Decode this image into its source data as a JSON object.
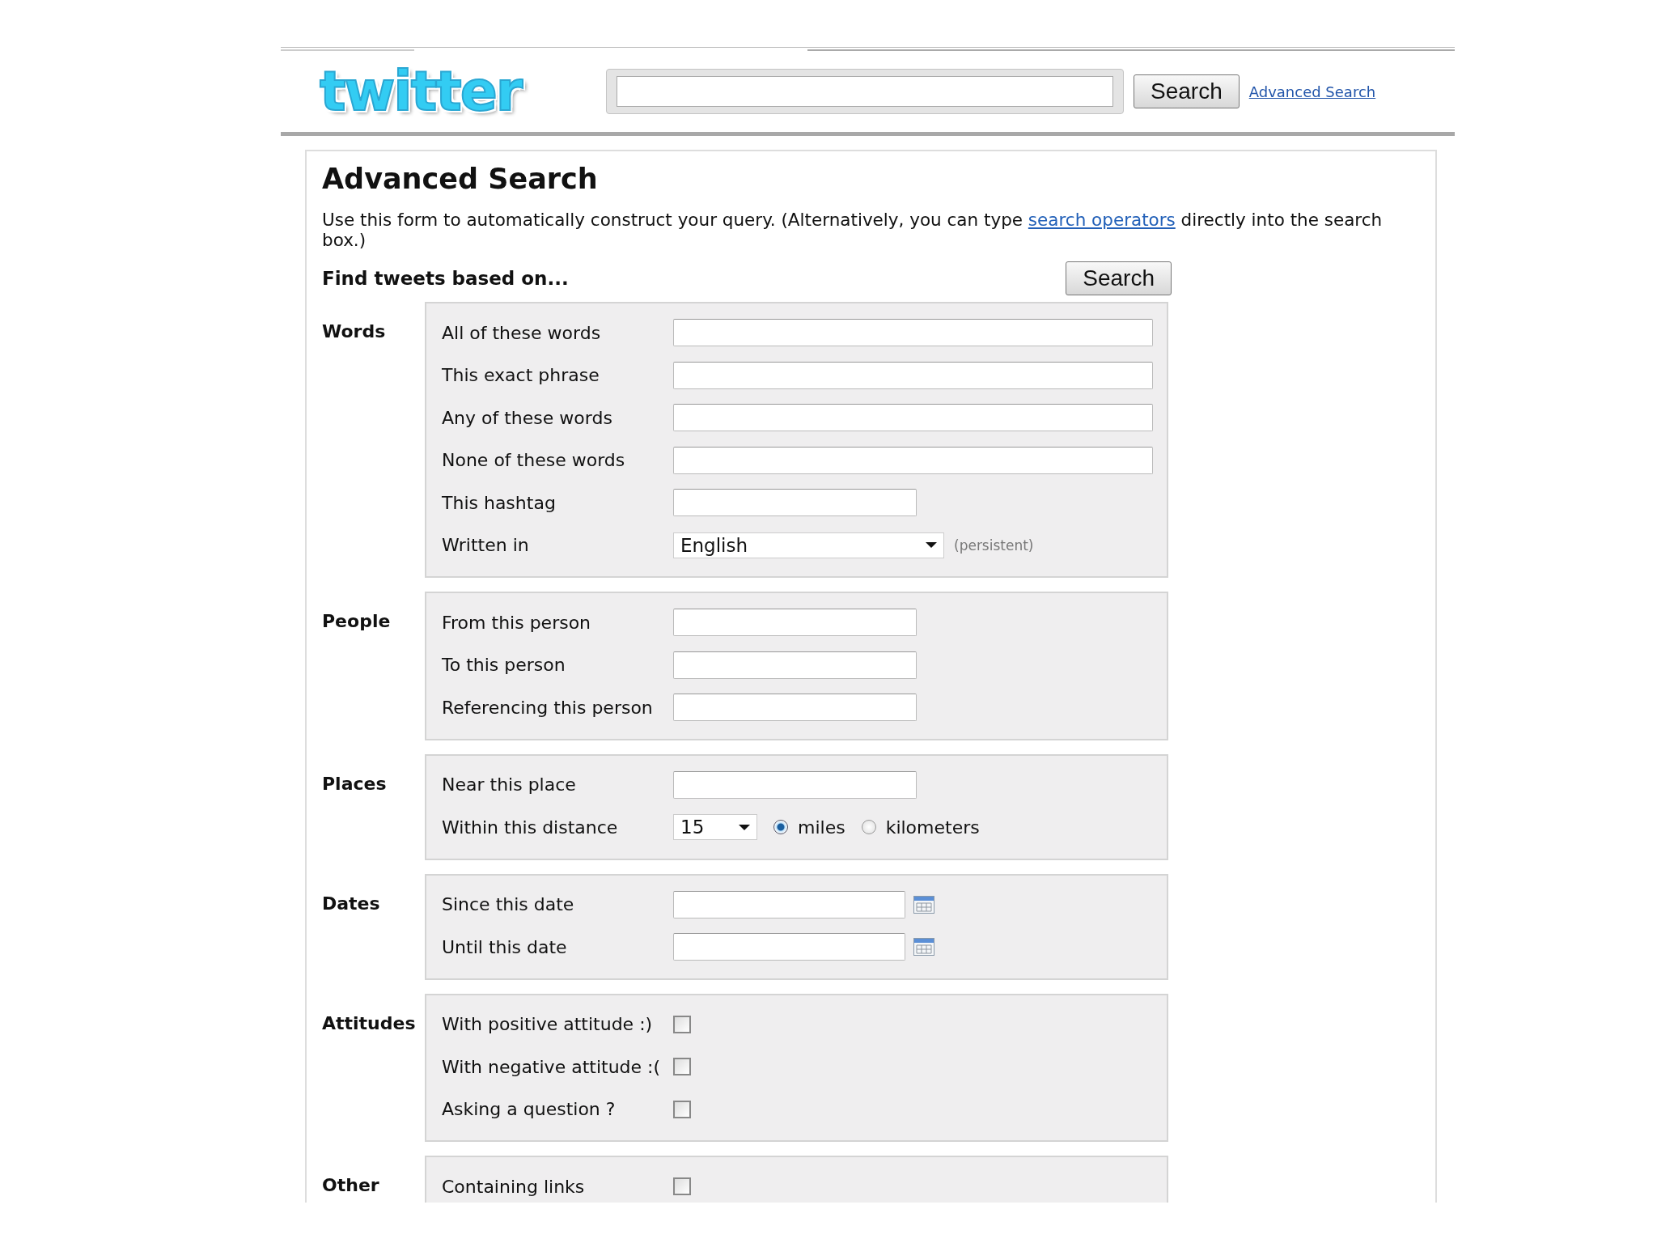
{
  "header": {
    "logo": "twitter",
    "search_button": "Search",
    "advanced_link": "Advanced Search"
  },
  "title": "Advanced Search",
  "intro": {
    "before": "Use this form to automatically construct your query. (Alternatively, you can type ",
    "link": "search operators",
    "after": " directly into the search box.)"
  },
  "find_label": "Find tweets based on...",
  "search_button": "Search",
  "sections": [
    {
      "label": "Words",
      "rows": [
        {
          "kind": "wide",
          "label": "All of these words"
        },
        {
          "kind": "wide",
          "label": "This exact phrase"
        },
        {
          "kind": "wide",
          "label": "Any of these words"
        },
        {
          "kind": "wide",
          "label": "None of these words"
        },
        {
          "kind": "narrow",
          "label": "This hashtag"
        },
        {
          "kind": "select",
          "label": "Written in",
          "value": "English",
          "note": "(persistent)"
        }
      ]
    },
    {
      "label": "People",
      "rows": [
        {
          "kind": "narrow",
          "label": "From this person"
        },
        {
          "kind": "narrow",
          "label": "To this person"
        },
        {
          "kind": "narrow",
          "label": "Referencing this person"
        }
      ]
    },
    {
      "label": "Places",
      "rows": [
        {
          "kind": "narrow",
          "label": "Near this place"
        },
        {
          "kind": "distance",
          "label": "Within this distance",
          "value": "15",
          "units": [
            {
              "label": "miles",
              "selected": true
            },
            {
              "label": "kilometers",
              "selected": false
            }
          ]
        }
      ]
    },
    {
      "label": "Dates",
      "rows": [
        {
          "kind": "date",
          "label": "Since this date"
        },
        {
          "kind": "date",
          "label": "Until this date"
        }
      ]
    },
    {
      "label": "Attitudes",
      "rows": [
        {
          "kind": "checkbox",
          "label": "With positive attitude :)",
          "checked": false
        },
        {
          "kind": "checkbox",
          "label": "With negative attitude :(",
          "checked": false
        },
        {
          "kind": "checkbox",
          "label": "Asking a question ?",
          "checked": false
        }
      ]
    },
    {
      "label": "Other",
      "rows": [
        {
          "kind": "checkbox",
          "label": "Containing links",
          "checked": false
        }
      ]
    }
  ]
}
